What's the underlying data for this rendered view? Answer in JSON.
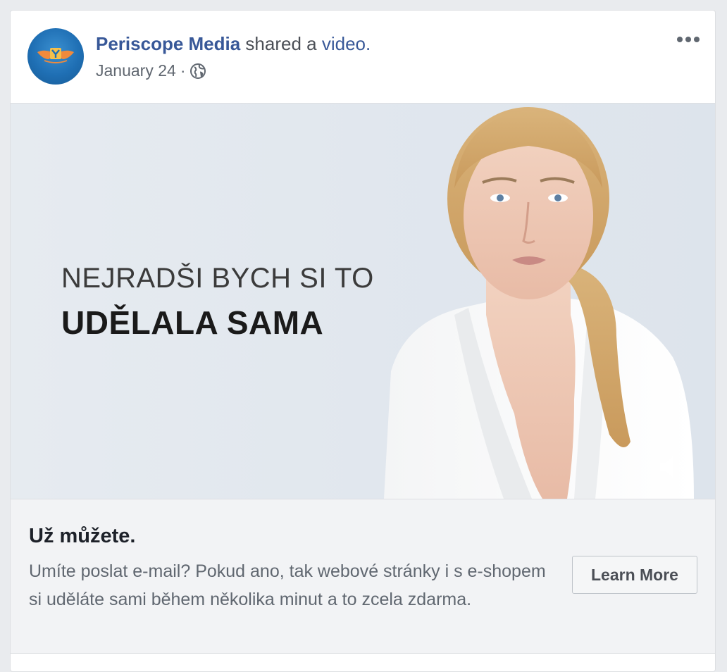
{
  "post": {
    "page_name": "Periscope Media",
    "action_text": " shared a ",
    "object_link": "video",
    "period": ".",
    "date": "January 24",
    "separator": "·",
    "privacy_icon": "globe-icon",
    "menu_icon": "more-options-icon"
  },
  "video": {
    "caption_line1": "NEJRADŠI BYCH SI TO",
    "caption_line2": "UDĚLALA SAMA",
    "mute_icon": "muted-speaker-icon"
  },
  "cta": {
    "headline": "Už můžete.",
    "description": "Umíte poslat e-mail? Pokud ano, tak webové stránky i s e-shopem si uděláte sami během několika minut a to zcela zdarma.",
    "button_label": "Learn More"
  },
  "colors": {
    "link_blue": "#385898",
    "text_gray": "#606770",
    "cta_background": "#f2f3f5",
    "avatar_blue": "#1f6fb4",
    "logo_orange": "#f08a3c"
  }
}
